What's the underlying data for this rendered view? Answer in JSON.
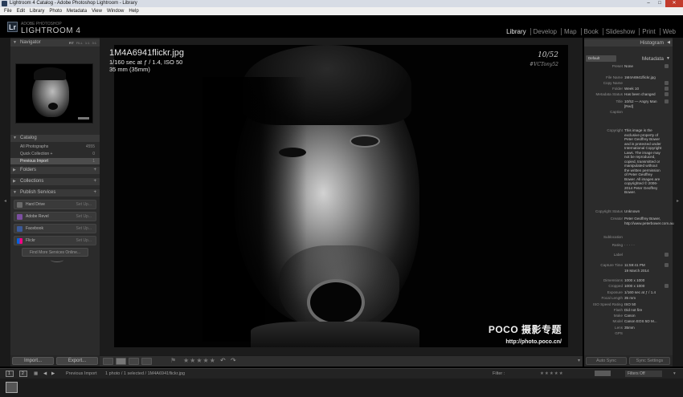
{
  "window": {
    "title": "Lightroom 4 Catalog - Adobe Photoshop Lightroom - Library",
    "minimize": "–",
    "maximize": "□",
    "close": "✕"
  },
  "menu": [
    "File",
    "Edit",
    "Library",
    "Photo",
    "Metadata",
    "View",
    "Window",
    "Help"
  ],
  "identity": {
    "badge": "Lr",
    "sub": "ADOBE PHOTOSHOP",
    "main": "LIGHTROOM 4"
  },
  "modules": [
    "Library",
    "Develop",
    "Map",
    "Book",
    "Slideshow",
    "Print",
    "Web"
  ],
  "active_module": "Library",
  "left_panel": {
    "navigator": {
      "label": "Navigator",
      "opts": [
        "FIT",
        "FILL",
        "1:1",
        "3:1"
      ]
    },
    "catalog": {
      "label": "Catalog",
      "rows": [
        {
          "label": "All Photographs",
          "count": "4555"
        },
        {
          "label": "Quick Collection +",
          "count": "0"
        },
        {
          "label": "Previous Import",
          "count": "1"
        }
      ]
    },
    "folders": "Folders",
    "collections": "Collections",
    "publish": "Publish Services",
    "services": [
      {
        "label": "Hard Drive",
        "setup": "Set Up...",
        "color": "#6a6a6a"
      },
      {
        "label": "Adobe Revel",
        "setup": "Set Up...",
        "color": "#7b4fa0"
      },
      {
        "label": "Facebook",
        "setup": "Set Up...",
        "color": "#3b5998"
      },
      {
        "label": "Flickr",
        "setup": "Set Up...",
        "color": "#ff0084"
      }
    ],
    "find_more": "Find More Services Online..."
  },
  "overlay": {
    "filename": "1M4A6941flickr.jpg",
    "exposure": "1/160 sec at ƒ / 1.4, ISO 50",
    "lens": "35 mm (35mm)"
  },
  "photo": {
    "sig1": "10/52",
    "sig2": "#VCTony52",
    "wm1": "POCO 摄影专题",
    "wm2": "http://photo.poco.cn/"
  },
  "bottom_left": {
    "import": "Import...",
    "export": "Export..."
  },
  "toolbar": {
    "stars": "★★★★★",
    "flag": "⚑",
    "rotl": "↶",
    "rotr": "↷",
    "more": "▾"
  },
  "right_panel": {
    "histogram": "Histogram",
    "metadata": "Metadata",
    "preset_select": "Default",
    "fields": [
      {
        "label": "Preset",
        "value": "None"
      },
      {
        "label": "File Name",
        "value": "1M4A6941flickr.jpg"
      },
      {
        "label": "Copy Name",
        "value": ""
      },
      {
        "label": "Folder",
        "value": "Week 10"
      },
      {
        "label": "Metadata Status",
        "value": "Has been changed"
      },
      {
        "label": "Title",
        "value": "10/52 — Angry Man [Red]"
      },
      {
        "label": "Caption",
        "value": ""
      },
      {
        "label": "Copyright",
        "value": "This image is the exclusive property of Peter Geoffrey Bower and is protected under International Copyright Laws. The image may not be reproduced, copied, transmitted or manipulated without the written permission of Peter Geoffrey Bower. All images are copyrighted © 2006-2014 Peter Geoffrey Bower."
      },
      {
        "label": "Copyright Status",
        "value": "Unknown"
      },
      {
        "label": "Creator",
        "value": "Peter Geoffrey Bower, http://www.peterbower.com.au"
      },
      {
        "label": "Sublocation",
        "value": ""
      },
      {
        "label": "Rating",
        "value": "· · · · ·"
      },
      {
        "label": "Label",
        "value": ""
      },
      {
        "label": "Capture Time",
        "value": "11:59:41 PM"
      },
      {
        "label": "",
        "value": "19 March 2014"
      },
      {
        "label": "Dimensions",
        "value": "1000 x 1000"
      },
      {
        "label": "Cropped",
        "value": "1000 x 1000"
      },
      {
        "label": "Exposure",
        "value": "1/160 sec at ƒ / 1.4"
      },
      {
        "label": "Focal Length",
        "value": "35 mm"
      },
      {
        "label": "ISO Speed Rating",
        "value": "ISO 50"
      },
      {
        "label": "Flash",
        "value": "Did not fire"
      },
      {
        "label": "Make",
        "value": "Canon"
      },
      {
        "label": "Model",
        "value": "Canon EOS 5D M..."
      },
      {
        "label": "Lens",
        "value": "35mm"
      },
      {
        "label": "GPS",
        "value": ""
      }
    ]
  },
  "sync": {
    "auto": "Auto Sync",
    "settings": "Sync Settings"
  },
  "filmbar": {
    "source": "Previous Import",
    "info": "1 photo / 1 selected / 1M4A6941flickr.jpg",
    "filter_label": "Filter :",
    "filters_off": "Filters Off",
    "page1": "1",
    "page2": "2"
  }
}
